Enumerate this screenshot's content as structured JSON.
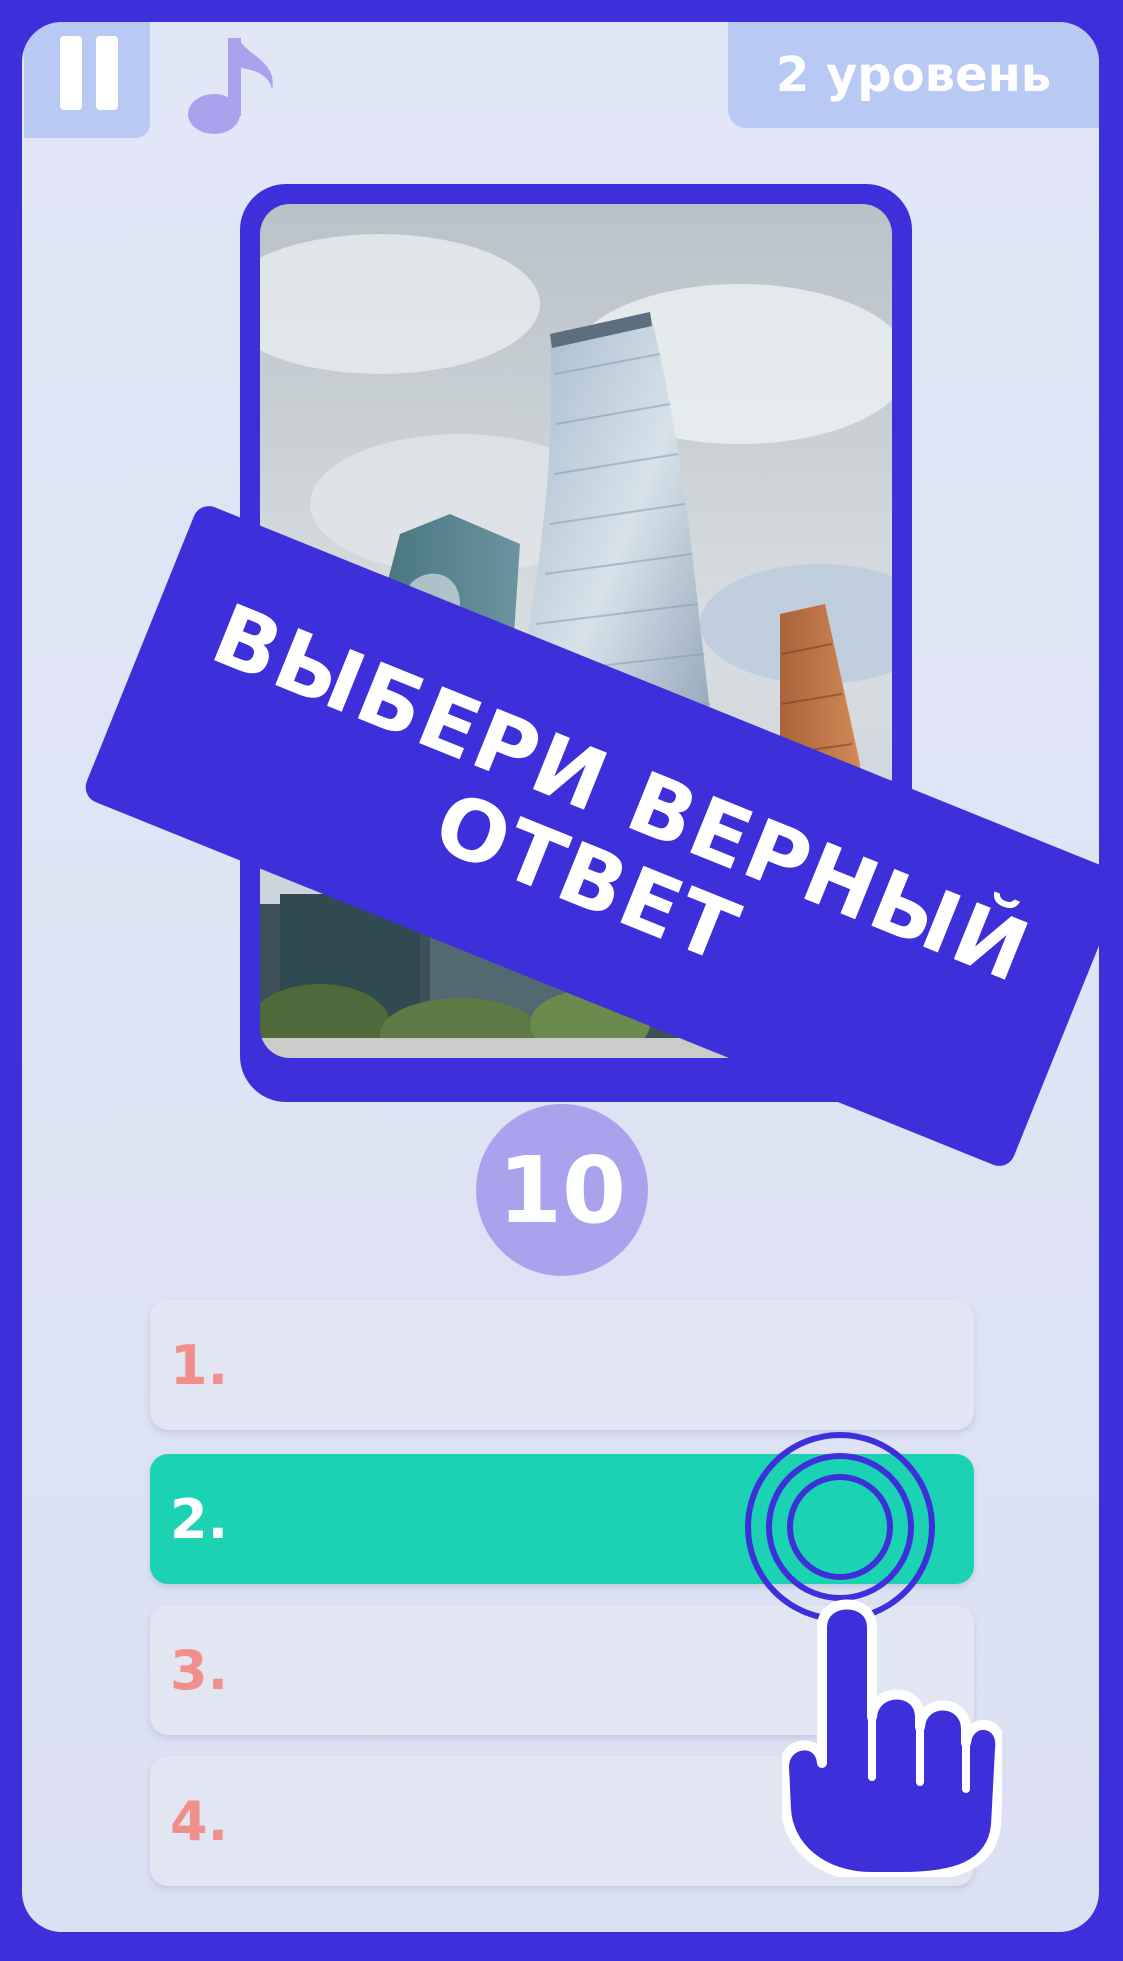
{
  "top_bar": {
    "pause_icon": "pause-icon",
    "music_icon": "music-note-icon",
    "level_label": "2 уровень"
  },
  "photo": {
    "description_icon": "skyscrapers-photo"
  },
  "banner": {
    "line1": "ВЫБЕРИ ВЕРНЫЙ",
    "line2": "ОТВЕТ"
  },
  "timer": {
    "value": "10"
  },
  "answers": [
    {
      "label": "1.",
      "selected": false
    },
    {
      "label": "2.",
      "selected": true
    },
    {
      "label": "3.",
      "selected": false
    },
    {
      "label": "4.",
      "selected": false
    }
  ],
  "colors": {
    "accent": "#3d2fd9",
    "selected": "#1bd3b2",
    "badge": "#b8c9f4",
    "answer_number": "#f08f8c",
    "timer_bg": "#a9a3ee"
  },
  "pointer_icon": "tap-hand-icon"
}
